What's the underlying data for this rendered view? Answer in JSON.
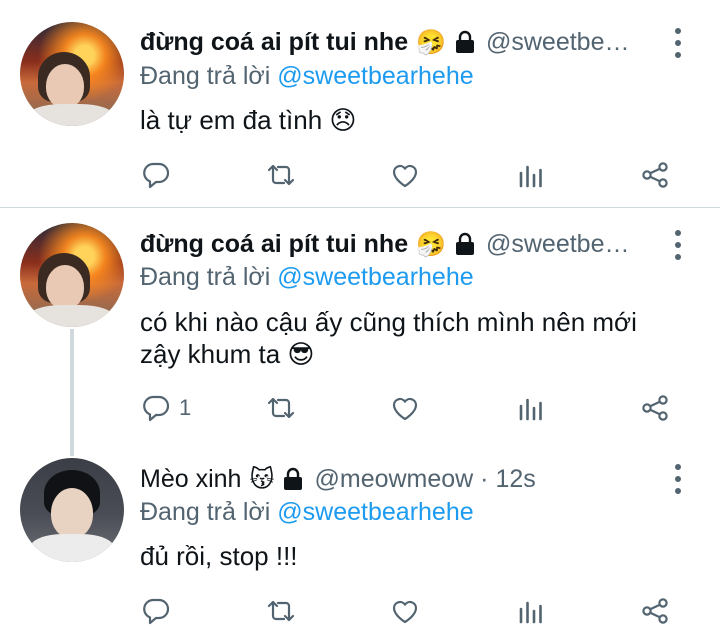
{
  "tweets": [
    {
      "name": "đừng coá ai pít tui nhe",
      "name_emoji": "🤧",
      "handle": "@sweetbe…",
      "reply_prefix": "Đang trả lời",
      "reply_to": "@sweetbearhehe",
      "text": "là tự em đa tình 😞",
      "reply_count": "",
      "avatar_icon": "avatar-fire-photo"
    },
    {
      "name": "đừng coá ai pít tui nhe",
      "name_emoji": "🤧",
      "handle": "@sweetbe…",
      "reply_prefix": "Đang trả lời",
      "reply_to": "@sweetbearhehe",
      "text": "có khi nào cậu ấy cũng thích mình nên mới zậy khum ta 😎",
      "reply_count": "1",
      "avatar_icon": "avatar-fire-photo"
    },
    {
      "name": "Mèo xinh",
      "name_emoji": "😽",
      "handle": "@meowmeow · 12s",
      "reply_prefix": "Đang trả lời",
      "reply_to": "@sweetbearhehe",
      "text": "đủ rồi, stop !!!",
      "reply_count": "",
      "avatar_icon": "avatar-portrait-photo"
    }
  ],
  "icons": {
    "reply": "reply-icon",
    "retweet": "retweet-icon",
    "like": "like-icon",
    "analytics": "analytics-icon",
    "share": "share-icon",
    "lock": "lock-icon",
    "more": "more-icon"
  },
  "colors": {
    "accent": "#1d9bf0",
    "secondary_text": "#536471",
    "divider": "#cfd9de"
  }
}
